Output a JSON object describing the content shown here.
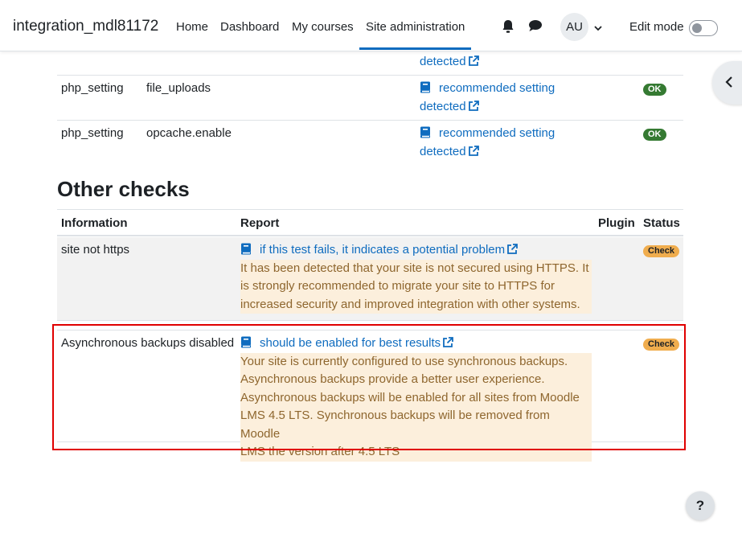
{
  "navbar": {
    "brand": "integration_mdl81172",
    "links": [
      "Home",
      "Dashboard",
      "My courses",
      "Site administration"
    ],
    "avatar_initials": "AU",
    "edit_mode_label": "Edit mode",
    "edit_mode_on": false
  },
  "php_rows": {
    "top_partial": {
      "report_tail": "detected"
    },
    "rows": [
      {
        "type": "php_setting",
        "name": "file_uploads",
        "report_link": "recommended setting",
        "report_tail": "detected",
        "status": "OK"
      },
      {
        "type": "php_setting",
        "name": "opcache.enable",
        "report_link": "recommended setting",
        "report_tail": "detected",
        "status": "OK"
      }
    ]
  },
  "other_checks": {
    "heading": "Other checks",
    "columns": {
      "information": "Information",
      "report": "Report",
      "plugin": "Plugin",
      "status": "Status"
    },
    "rows": [
      {
        "information": "site not https",
        "report_link": "if this test fails, it indicates a potential problem",
        "message_lines": [
          "It has been detected that your site is not secured using HTTPS. It",
          "is strongly recommended to migrate your site to HTTPS for",
          "increased security and improved integration with other systems."
        ],
        "plugin": "",
        "status": "Check"
      },
      {
        "information": "Asynchronous backups disabled",
        "report_link": "should be enabled for best results",
        "message_lines": [
          "Your site is currently configured to use synchronous backups.",
          "Asynchronous backups provide a better user experience.",
          "Asynchronous backups will be enabled for all sites from Moodle",
          "LMS 4.5 LTS. Synchronous backups will be removed from Moodle",
          "LMS the version after 4.5 LTS"
        ],
        "plugin": "",
        "status": "Check"
      }
    ]
  },
  "help_button": "?",
  "colors": {
    "link": "#0f6cbf",
    "ok_badge": "#357a32",
    "check_badge": "#f0ad4e",
    "warning_bg": "#fcefdc",
    "warning_text": "#8e662e",
    "highlight": "#e00000"
  },
  "icons": [
    "bell-icon",
    "chat-icon",
    "chevron-down-icon",
    "book-icon",
    "external-link-icon",
    "chevron-left-icon",
    "question-icon"
  ]
}
